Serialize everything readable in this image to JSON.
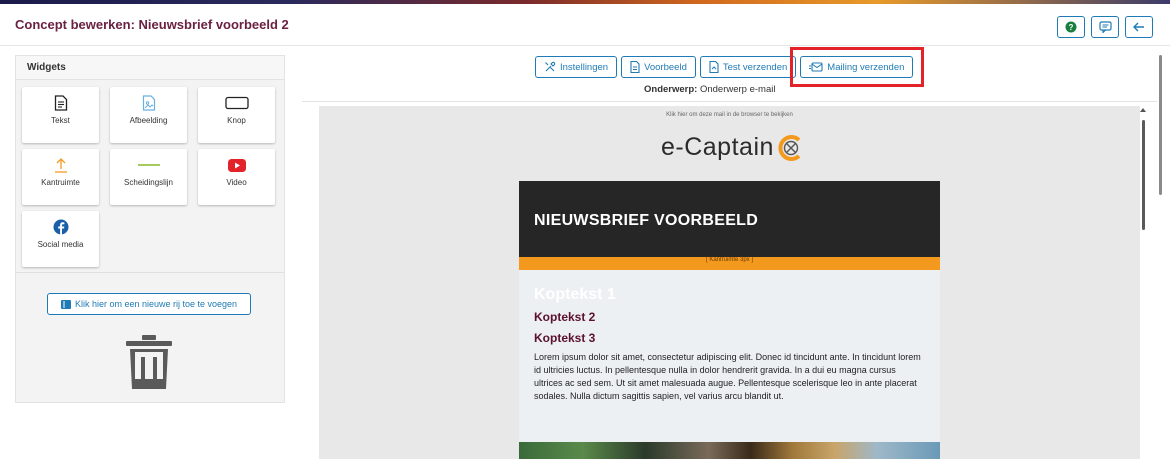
{
  "header": {
    "title": "Concept bewerken: Nieuwsbrief voorbeeld 2",
    "buttons": [
      {
        "name": "help-icon",
        "color": "#1a7f3c"
      },
      {
        "name": "comment-icon"
      },
      {
        "name": "back-arrow-icon"
      }
    ]
  },
  "widgets": {
    "title": "Widgets",
    "items": [
      {
        "label": "Tekst",
        "icon": "document-icon"
      },
      {
        "label": "Afbeelding",
        "icon": "image-icon"
      },
      {
        "label": "Knop",
        "icon": "button-icon"
      },
      {
        "label": "Kantruimte",
        "icon": "arrow-up-icon"
      },
      {
        "label": "Scheidingslijn",
        "icon": "divider-icon"
      },
      {
        "label": "Video",
        "icon": "youtube-icon"
      },
      {
        "label": "Social media",
        "icon": "facebook-icon"
      }
    ],
    "add_row_label": "Klik hier om een nieuwe rij toe te voegen"
  },
  "toolbar": {
    "settings": "Instellingen",
    "preview": "Voorbeeld",
    "test_send": "Test verzenden",
    "mailing_send": "Mailing verzenden"
  },
  "subject": {
    "label": "Onderwerp:",
    "value": "Onderwerp e-mail"
  },
  "email": {
    "browser_link": "Klik hier om deze mail in de browser te bekijken",
    "logo_text": "e-Captain",
    "banner_title": "NIEUWSBRIEF VOORBEELD",
    "kantruimte_label": "[ Kantruimte 3px ]",
    "kop1": "Koptekst 1",
    "kop2": "Koptekst 2",
    "kop3": "Koptekst 3",
    "lorem": "Lorem ipsum dolor sit amet, consectetur adipiscing elit. Donec id tincidunt ante. In tincidunt lorem id ultricies luctus. In pellentesque nulla in dolor hendrerit gravida. In a dui eu magna cursus ultrices ac sed sem. Ut sit amet malesuada augue. Pellentesque scelerisque leo in ante placerat sodales. Nulla dictum sagittis sapien, vel varius arcu blandit ut."
  },
  "colors": {
    "accent": "#1f7bb5",
    "title": "#6b2140",
    "highlight": "#e3232a",
    "orange": "#f39a1e"
  }
}
